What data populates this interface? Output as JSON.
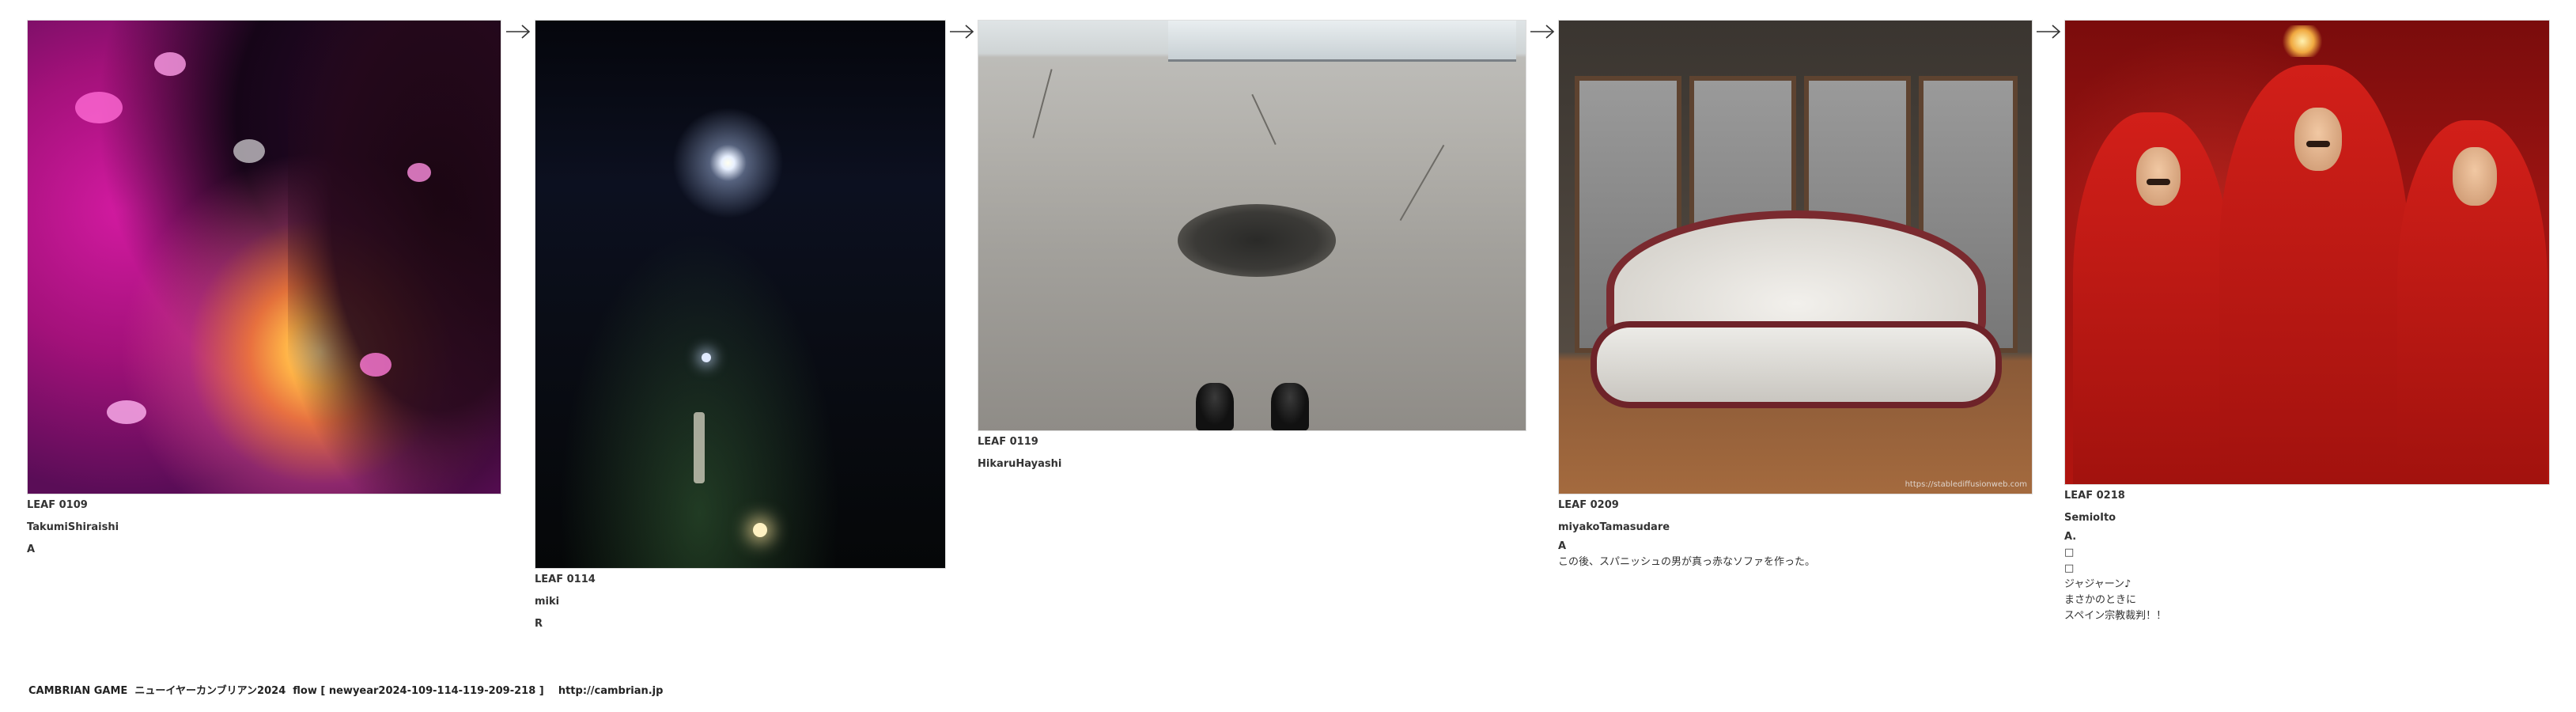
{
  "leaves": [
    {
      "id": "LEAF 0109",
      "author": "TakumiShiraishi",
      "notes": [
        "A"
      ]
    },
    {
      "id": "LEAF 0114",
      "author": "miki",
      "notes": [
        "R"
      ]
    },
    {
      "id": "LEAF 0119",
      "author": "HikaruHayashi",
      "notes": []
    },
    {
      "id": "LEAF 0209",
      "author": "miyakoTamasudare",
      "notes": [
        "A",
        "この後、スパニッシュの男が真っ赤なソファを作った。"
      ],
      "watermark": "https://stablediffusionweb.com"
    },
    {
      "id": "LEAF 0218",
      "author": "SemioIto",
      "notes": [
        "A.",
        "□",
        "□",
        "ジャジャーン♪",
        "まさかのときに",
        "スペイン宗教裁判！！"
      ]
    }
  ],
  "footer": {
    "text": "CAMBRIAN GAME  ニューイヤーカンブリアン2024  flow [ newyear2024-109-114-119-209-218 ]    http://cambrian.jp"
  },
  "icons": {
    "arrow": "right-arrow-icon"
  }
}
